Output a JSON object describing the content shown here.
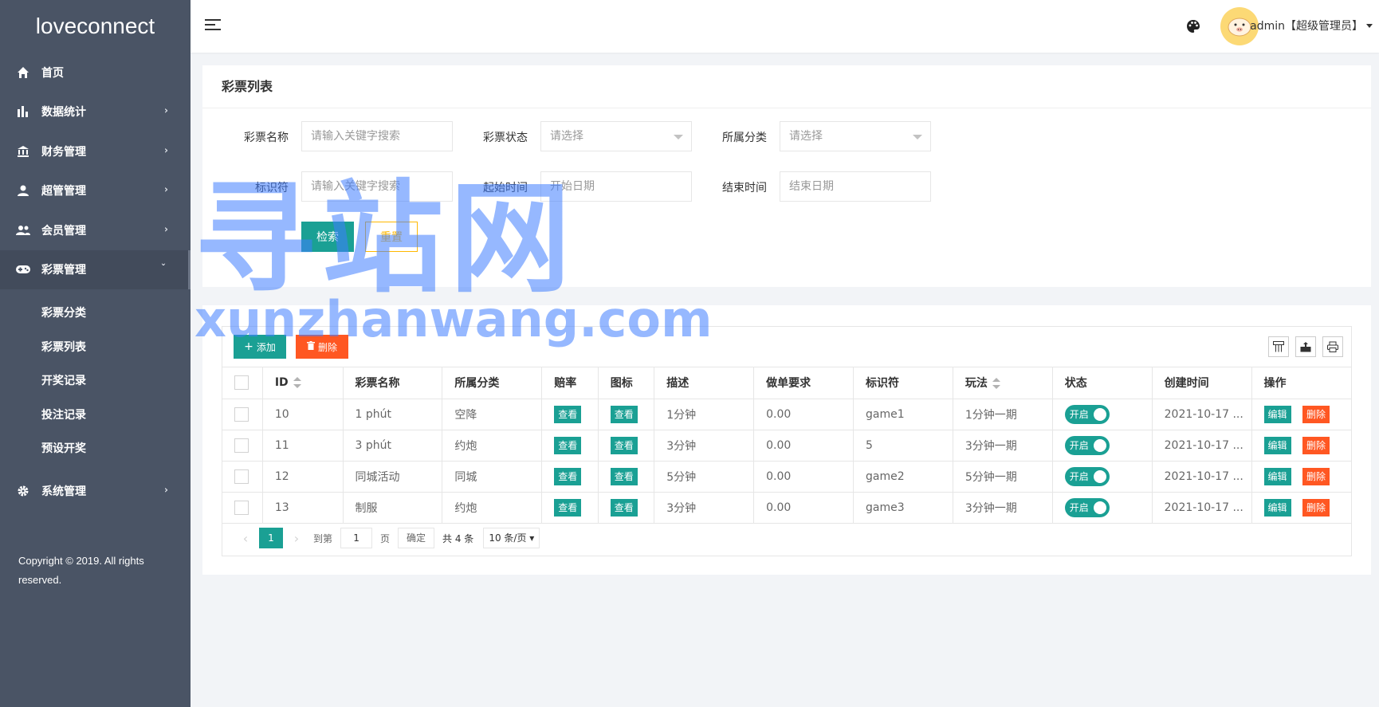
{
  "app": {
    "logo": "loveconnect"
  },
  "sidebar": {
    "items": [
      {
        "label": "首页",
        "icon": "home-icon",
        "arrow": ""
      },
      {
        "label": "数据统计",
        "icon": "bar-chart-icon",
        "arrow": "›"
      },
      {
        "label": "财务管理",
        "icon": "bank-icon",
        "arrow": "›"
      },
      {
        "label": "超管管理",
        "icon": "person-icon",
        "arrow": "›"
      },
      {
        "label": "会员管理",
        "icon": "group-icon",
        "arrow": "›"
      },
      {
        "label": "彩票管理",
        "icon": "gamepad-icon",
        "arrow": "ˇ"
      }
    ],
    "subitems": [
      {
        "label": "彩票分类"
      },
      {
        "label": "彩票列表"
      },
      {
        "label": "开奖记录"
      },
      {
        "label": "投注记录"
      },
      {
        "label": "预设开奖"
      }
    ],
    "system": {
      "label": "系统管理",
      "icon": "gear-icon",
      "arrow": "›"
    },
    "copyright": "Copyright © 2019. All rights reserved."
  },
  "header": {
    "user": "admin【超级管理员】"
  },
  "search": {
    "title": "彩票列表",
    "fields": {
      "name_label": "彩票名称",
      "name_placeholder": "请输入关键字搜索",
      "status_label": "彩票状态",
      "status_value": "请选择",
      "category_label": "所属分类",
      "category_value": "请选择",
      "code_label": "标识符",
      "code_placeholder": "请输入关键字搜索",
      "start_label": "起始时间",
      "start_placeholder": "开始日期",
      "end_label": "结束时间",
      "end_placeholder": "结束日期"
    },
    "search_btn": "检索",
    "reset_btn": "重置"
  },
  "table": {
    "add_btn": "添加",
    "delete_btn": "删除",
    "columns": [
      "ID",
      "彩票名称",
      "所属分类",
      "赔率",
      "图标",
      "描述",
      "做单要求",
      "标识符",
      "玩法",
      "状态",
      "创建时间",
      "操作"
    ],
    "view_label": "查看",
    "switch_label": "开启",
    "edit_label": "编辑",
    "remove_label": "删除",
    "rows": [
      {
        "id": "10",
        "name": "1 phút",
        "category": "空降",
        "desc": "1分钟",
        "req": "0.00",
        "code": "game1",
        "play": "1分钟一期",
        "created": "2021-10-17 ..."
      },
      {
        "id": "11",
        "name": "3 phút",
        "category": "约炮",
        "desc": "3分钟",
        "req": "0.00",
        "code": "5",
        "play": "3分钟一期",
        "created": "2021-10-17 ..."
      },
      {
        "id": "12",
        "name": "同城活动",
        "category": "同城",
        "desc": "5分钟",
        "req": "0.00",
        "code": "game2",
        "play": "5分钟一期",
        "created": "2021-10-17 ..."
      },
      {
        "id": "13",
        "name": "制服",
        "category": "约炮",
        "desc": "3分钟",
        "req": "0.00",
        "code": "game3",
        "play": "3分钟一期",
        "created": "2021-10-17 ..."
      }
    ]
  },
  "pager": {
    "current": "1",
    "goto_label": "到第",
    "goto_value": "1",
    "page_unit": "页",
    "confirm": "确定",
    "total": "共 4 条",
    "page_size": "10 条/页"
  },
  "watermark": {
    "big": "寻站网",
    "small": "xunzhanwang.com"
  }
}
